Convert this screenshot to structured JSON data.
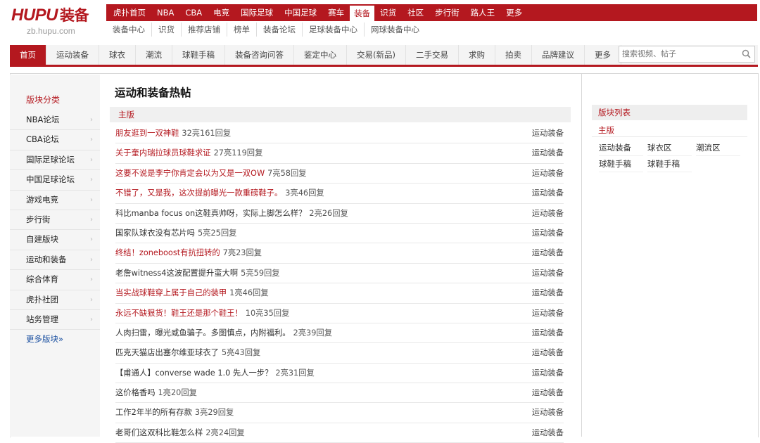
{
  "logo": {
    "main": "HUPU",
    "cn": "装备",
    "sub": "zb.hupu.com"
  },
  "top_nav": [
    "虎扑首页",
    "NBA",
    "CBA",
    "电竞",
    "国际足球",
    "中国足球",
    "赛车",
    "装备",
    "识货",
    "社区",
    "步行街",
    "路人王",
    "更多"
  ],
  "top_nav_active": "装备",
  "sub_nav": [
    "装备中心",
    "识货",
    "推荐店铺",
    "榜单",
    "装备论坛",
    "足球装备中心",
    "网球装备中心"
  ],
  "main_nav": [
    "首页",
    "运动装备",
    "球衣",
    "潮流",
    "球鞋手稿",
    "装备咨询问答",
    "鉴定中心",
    "交易(新品)",
    "二手交易",
    "求购",
    "拍卖",
    "品牌建议",
    "更多"
  ],
  "main_nav_active": "首页",
  "search": {
    "placeholder": "搜索视频、帖子"
  },
  "sidebar": {
    "title": "版块分类",
    "items": [
      "NBA论坛",
      "CBA论坛",
      "国际足球论坛",
      "中国足球论坛",
      "游戏电竞",
      "步行街",
      "自建版块",
      "运动和装备",
      "综合体育",
      "虎扑社团",
      "站务管理"
    ],
    "more": "更多版块»"
  },
  "content": {
    "title": "运动和装备热帖",
    "section": "主版",
    "threads": [
      {
        "title": "朋友逛到一双神鞋",
        "stats": "32亮161回复",
        "category": "运动装备",
        "hot": true
      },
      {
        "title": "关于奎内瑞拉球员球鞋求证",
        "stats": "27亮119回复",
        "category": "运动装备",
        "hot": true
      },
      {
        "title": "这要不说是李宁你肯定会以为又是一双OW",
        "stats": "7亮58回复",
        "category": "运动装备",
        "hot": true
      },
      {
        "title": "不错了，又是我，这次提前曝光一款重磅鞋子。",
        "stats": "3亮46回复",
        "category": "运动装备",
        "hot": true
      },
      {
        "title": "科比manba focus on这鞋真帅呀，实际上脚怎么样？",
        "stats": "2亮26回复",
        "category": "运动装备",
        "hot": false
      },
      {
        "title": "国家队球衣没有芯片吗",
        "stats": "5亮25回复",
        "category": "运动装备",
        "hot": false
      },
      {
        "title": "终结！zoneboost有抗扭转的",
        "stats": "7亮23回复",
        "category": "运动装备",
        "hot": true
      },
      {
        "title": "老詹witness4这波配置提升蛮大啊",
        "stats": "5亮59回复",
        "category": "运动装备",
        "hot": false
      },
      {
        "title": "当实战球鞋穿上属于自己的装甲",
        "stats": "1亮46回复",
        "category": "运动装备",
        "hot": true
      },
      {
        "title": "永远不缺狠货！鞋王还是那个鞋王！",
        "stats": "10亮35回复",
        "category": "运动装备",
        "hot": true
      },
      {
        "title": "人肉扫雷，曝光咸鱼骗子。多图慎点，内附福利。",
        "stats": "2亮39回复",
        "category": "运动装备",
        "hot": false
      },
      {
        "title": "匹克天猫店出塞尔维亚球衣了",
        "stats": "5亮43回复",
        "category": "运动装备",
        "hot": false
      },
      {
        "title": "【甫通人】converse wade 1.0 先人一步？",
        "stats": "2亮31回复",
        "category": "运动装备",
        "hot": false
      },
      {
        "title": "这价格香吗",
        "stats": "1亮20回复",
        "category": "运动装备",
        "hot": false
      },
      {
        "title": "工作2年半的所有存款",
        "stats": "3亮29回复",
        "category": "运动装备",
        "hot": false
      },
      {
        "title": "老哥们这双科比鞋怎么样",
        "stats": "2亮24回复",
        "category": "运动装备",
        "hot": false
      }
    ]
  },
  "right": {
    "title": "版块列表",
    "sub": "主版",
    "boards": [
      "运动装备",
      "球衣区",
      "潮流区",
      "球鞋手稿",
      "球鞋手稿"
    ]
  },
  "colors": {
    "brand_red": "#b4181f",
    "link_blue": "#1a4fa0"
  },
  "icons": {
    "search": "search-icon",
    "chevron": "chevron-right-icon"
  }
}
